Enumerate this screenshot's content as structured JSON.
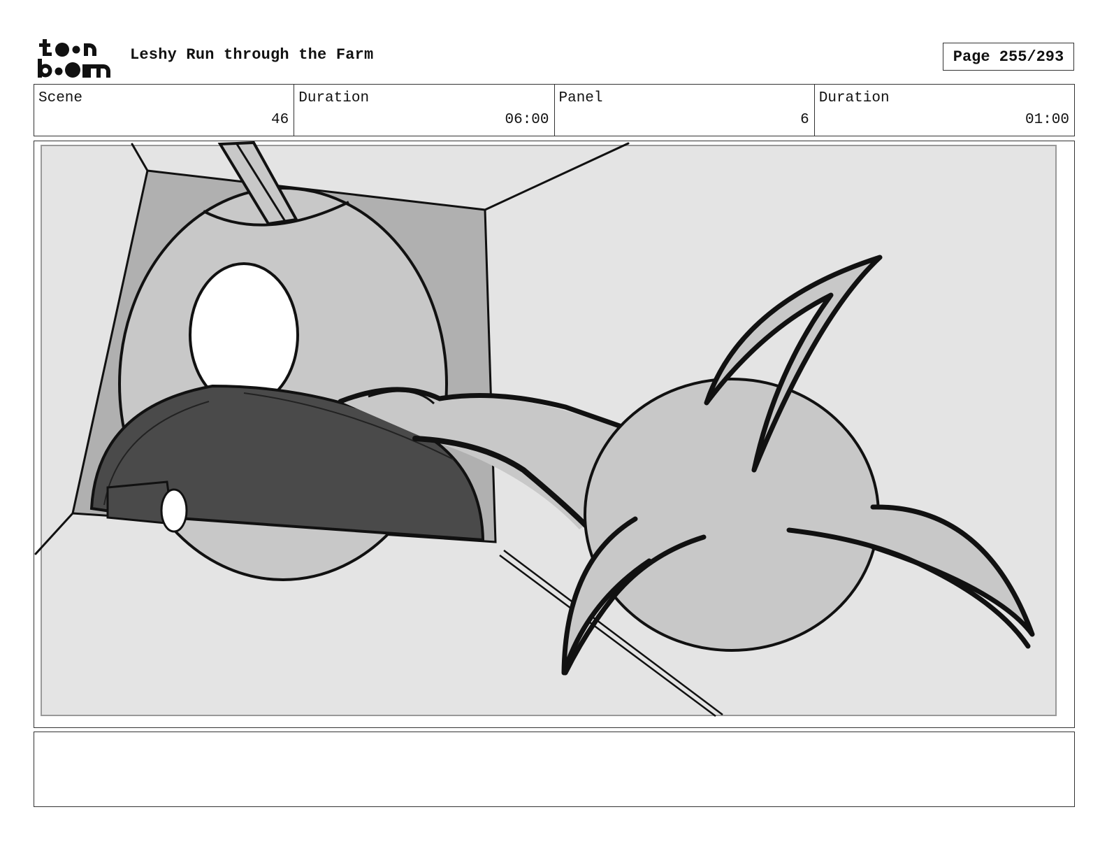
{
  "header": {
    "logo_text": "toon boom",
    "title": "Leshy Run through the Farm",
    "page": "Page 255/293"
  },
  "info": {
    "scene_label": "Scene",
    "scene_value": "46",
    "scene_duration_label": "Duration",
    "scene_duration_value": "06:00",
    "panel_label": "Panel",
    "panel_value": "6",
    "panel_duration_label": "Duration",
    "panel_duration_value": "01:00"
  },
  "notes": {
    "text": ""
  },
  "colors": {
    "frame": "#333333",
    "sketch_bg": "#e4e4e4",
    "sketch_mid": "#c8c8c8",
    "sketch_dark": "#4a4a4a"
  }
}
